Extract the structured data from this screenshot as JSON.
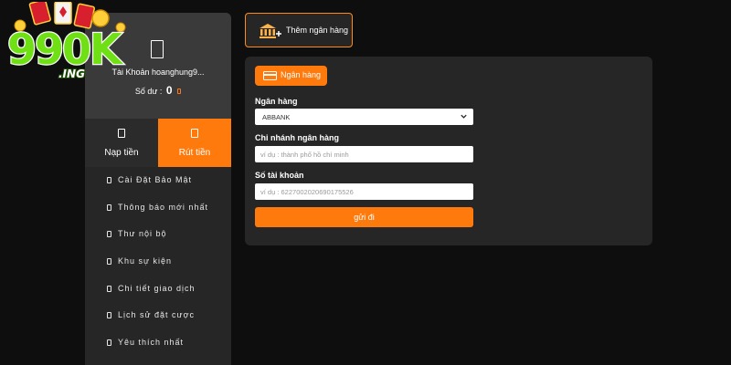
{
  "brand": {
    "logo_text": "990K",
    "logo_suffix": ".ING",
    "accent": "#ff7a0d",
    "logo_green": "#6ee014"
  },
  "sidebar": {
    "account_name": "Tài Khoản hoanghung9...",
    "balance_label": "Số dư :",
    "balance_value": "0",
    "tabs": [
      {
        "label": "Nạp tiền",
        "icon": "mobile-icon",
        "active": false
      },
      {
        "label": "Rút tiền",
        "icon": "mobile-icon",
        "active": true
      }
    ],
    "menu": [
      {
        "label": "Cài Đặt Bảo Mật",
        "icon": "lock-icon"
      },
      {
        "label": "Thông báo mới nhất",
        "icon": "bell-icon"
      },
      {
        "label": "Thư nội bộ",
        "icon": "mail-icon"
      },
      {
        "label": "Khu sự kiện",
        "icon": "gift-icon"
      },
      {
        "label": "Chi tiết giao dịch",
        "icon": "receipt-icon"
      },
      {
        "label": "Lịch sử đặt cược",
        "icon": "history-icon"
      },
      {
        "label": "Yêu thích nhất",
        "icon": "heart-icon"
      }
    ]
  },
  "toolbar": {
    "add_bank_label": "Thêm ngân hàng",
    "add_bank_icon": "bank-add-icon"
  },
  "form": {
    "chip_label": "Ngân hàng",
    "bank_label": "Ngân hàng",
    "bank_value": "ABBANK",
    "branch_label": "Chi nhánh ngân hàng",
    "branch_placeholder": "ví dụ : thành phố hồ chí minh",
    "account_label": "Số tài khoản",
    "account_placeholder": "ví dụ : 6227002020690175526",
    "submit_label": "gửi đi"
  }
}
